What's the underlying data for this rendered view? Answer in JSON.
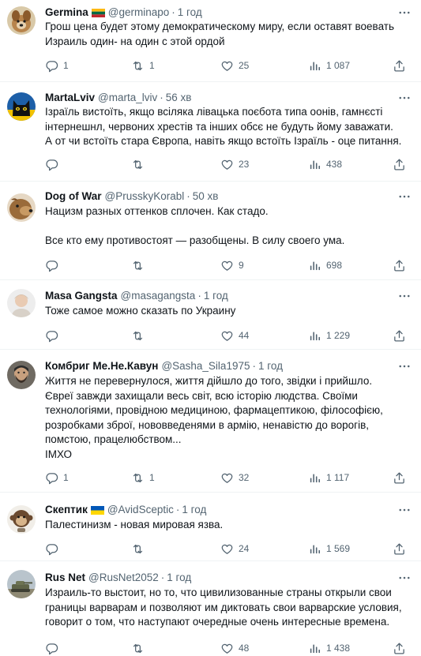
{
  "tweets": [
    {
      "name": "Germina",
      "flag": "lt",
      "handle": "@germinapo",
      "time": "1 год",
      "text": "Грош цена будет этому демократическому миру, если оставят воевать\nИзраиль один- на один с этой ордой",
      "replies": "1",
      "retweets": "1",
      "likes": "25",
      "views": "1 087",
      "avatar": "dog-tan"
    },
    {
      "name": "MartaLviv",
      "flag": "",
      "handle": "@marta_lviv",
      "time": "56 хв",
      "text": "Ізраїль вистоїть, якщо всіляка лівацька поєбота типа оонів, гамнєсті\nінтернешнл, червоних хрестів та інших обсє не будуть йому заважати.\nА от чи встоїть стара Європа, навіть якщо встоїть Ізраїль - оце питання.",
      "replies": "",
      "retweets": "",
      "likes": "23",
      "views": "438",
      "avatar": "cat-black"
    },
    {
      "name": "Dog of War",
      "flag": "",
      "handle": "@PrusskyKorabl",
      "time": "50 хв",
      "text": "Нацизм разных оттенков сплочен. Как стадо.\n\nВсе кто ему противостоят — разобщены. В силу своего ума.",
      "replies": "",
      "retweets": "",
      "likes": "9",
      "views": "698",
      "avatar": "dog-brown"
    },
    {
      "name": "Masa Gangsta",
      "flag": "",
      "handle": "@masagangsta",
      "time": "1 год",
      "text": "Тоже самое можно сказать по Украину",
      "replies": "",
      "retweets": "",
      "likes": "44",
      "views": "1 229",
      "avatar": "person-light"
    },
    {
      "name": "Комбриг Ме.Не.Кавун",
      "flag": "",
      "handle": "@Sasha_Sila1975",
      "time": "1 год",
      "text": "Життя не перевернулося, життя дійшло до того, звідки і прийшло.\nЄвреї завжди захищали весь світ, всю історію людства. Своїми\nтехнологіями, провідною медициною, фармацептикою, філософією,\nрозробками зброї, нововведенями в армію, ненавістю до ворогів,\nпомстою, працелюбством...\nІМХО",
      "replies": "1",
      "retweets": "1",
      "likes": "32",
      "views": "1 117",
      "avatar": "man-beard"
    },
    {
      "name": "Скептик",
      "flag": "ua",
      "handle": "@AvidSceptic",
      "time": "1 год",
      "text": "Палестинизм - новая мировая язва.",
      "replies": "",
      "retweets": "",
      "likes": "24",
      "views": "1 569",
      "avatar": "monkey"
    },
    {
      "name": "Rus Net",
      "flag": "",
      "handle": "@RusNet2052",
      "time": "1 год",
      "text": "Израиль-то выстоит, но то, что  цивилизованные страны открыли свои\nграницы варварам и позволяют им диктовать свои варварские условия,\nговорит о том, что наступают очередные очень интересные времена.",
      "replies": "",
      "retweets": "",
      "likes": "48",
      "views": "1 438",
      "avatar": "tank"
    }
  ],
  "colors": {
    "text": "#0f1419",
    "secondary": "#536471",
    "divider": "#eff3f4"
  },
  "icons": [
    "more-icon",
    "reply-icon",
    "retweet-icon",
    "like-icon",
    "views-icon",
    "share-icon"
  ]
}
